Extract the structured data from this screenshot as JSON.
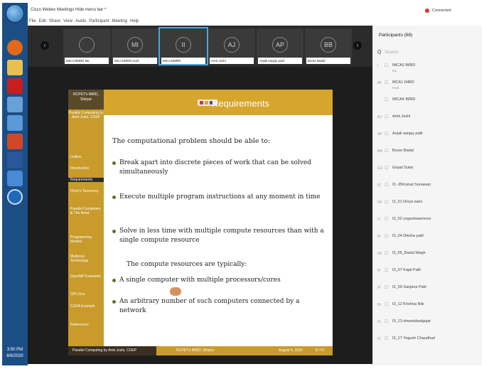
{
  "window": {
    "title": "Cisco Webex Meetings   Hide menu bar ^"
  },
  "menu": [
    "File",
    "Edit",
    "Share",
    "View",
    "Audio",
    "Participant",
    "Meeting",
    "Help"
  ],
  "connection": {
    "label": "Connected"
  },
  "strip": {
    "thumbs": [
      {
        "initials": "",
        "caption": "IMCA3IMRD Me"
      },
      {
        "initials": "MI",
        "caption": "MCA1IMRD Host"
      },
      {
        "initials": "II",
        "caption": "IMCA4IMRD"
      },
      {
        "initials": "AJ",
        "caption": "Amit Joshi"
      },
      {
        "initials": "AP",
        "caption": "Anjali sanjay patil"
      },
      {
        "initials": "BB",
        "caption": "Borse Badal"
      }
    ]
  },
  "slide": {
    "title": "Requirements",
    "side_head": "RCPET's IMRD, Shirpur",
    "side_sub": "Parallel Computing by Amit Joshi, COEP",
    "nav_items": [
      "Outline",
      "Introduction",
      "Requirements",
      "Flynn's Taxonomy",
      "Parallel Computers & The Need",
      "Programming Models",
      "Multicore Technology",
      "OpenMP Examples",
      "GPU Era",
      "CUDA Example",
      "References"
    ],
    "lead": "The computational problem should be able to:",
    "bullets": [
      "Break apart into discrete pieces of work that can be solved simultaneously",
      "Execute multiple program instructions at any moment in time",
      "Solve in less time with multiple compute resources than with a single compute resource"
    ],
    "typical": "The compute resources are typically:",
    "bullets2": [
      "A single computer with multiple processors/cores",
      "An arbitrary number of such computers connected by a network"
    ],
    "footer": {
      "left": "Parallel Computing by Amit Joshi, COEP",
      "mid": "RCPET's IMRD, Shirpur",
      "date": "August 6, 2020",
      "page": "8 / 51"
    }
  },
  "participants": {
    "header": "Participants (68)",
    "search_placeholder": "Search",
    "list": [
      {
        "av": "I",
        "name": "IMCA3 IMRD",
        "role": "Me"
      },
      {
        "av": "MI",
        "name": "MCA1 IMRD",
        "role": "Host"
      },
      {
        "av": "",
        "name": "IMCA4 IMRD",
        "role": ""
      },
      {
        "av": "AJ",
        "name": "Amit Joshi",
        "role": ""
      },
      {
        "av": "AP",
        "name": "Anjali sanjay patil",
        "role": ""
      },
      {
        "av": "BB",
        "name": "Borse Badal",
        "role": ""
      },
      {
        "av": "GS",
        "name": "Gopal Sutar",
        "role": ""
      },
      {
        "av": "IS",
        "name": "I3 -35Komal Sonawan",
        "role": ""
      },
      {
        "av": "IW",
        "name": "I3_01 Divya wani",
        "role": ""
      },
      {
        "av": "IY",
        "name": "I3_02 yogeshwarmore",
        "role": ""
      },
      {
        "av": "IP",
        "name": "I3_04 Diksha patil",
        "role": ""
      },
      {
        "av": "IW",
        "name": "I3_05_Badal Wagh",
        "role": ""
      },
      {
        "av": "IP",
        "name": "I3_07 Kajal Patil",
        "role": ""
      },
      {
        "av": "IP",
        "name": "I3_09 Sanjana Patil",
        "role": ""
      },
      {
        "av": "IN",
        "name": "I3_12 Krishna Nile",
        "role": ""
      },
      {
        "av": "IS",
        "name": "I3_13 shwetabadgujar",
        "role": ""
      },
      {
        "av": "IC",
        "name": "I3_17 Yogesh Chaudhari",
        "role": ""
      }
    ]
  },
  "clock": {
    "time": "3:50 PM",
    "date": "8/6/2020"
  }
}
